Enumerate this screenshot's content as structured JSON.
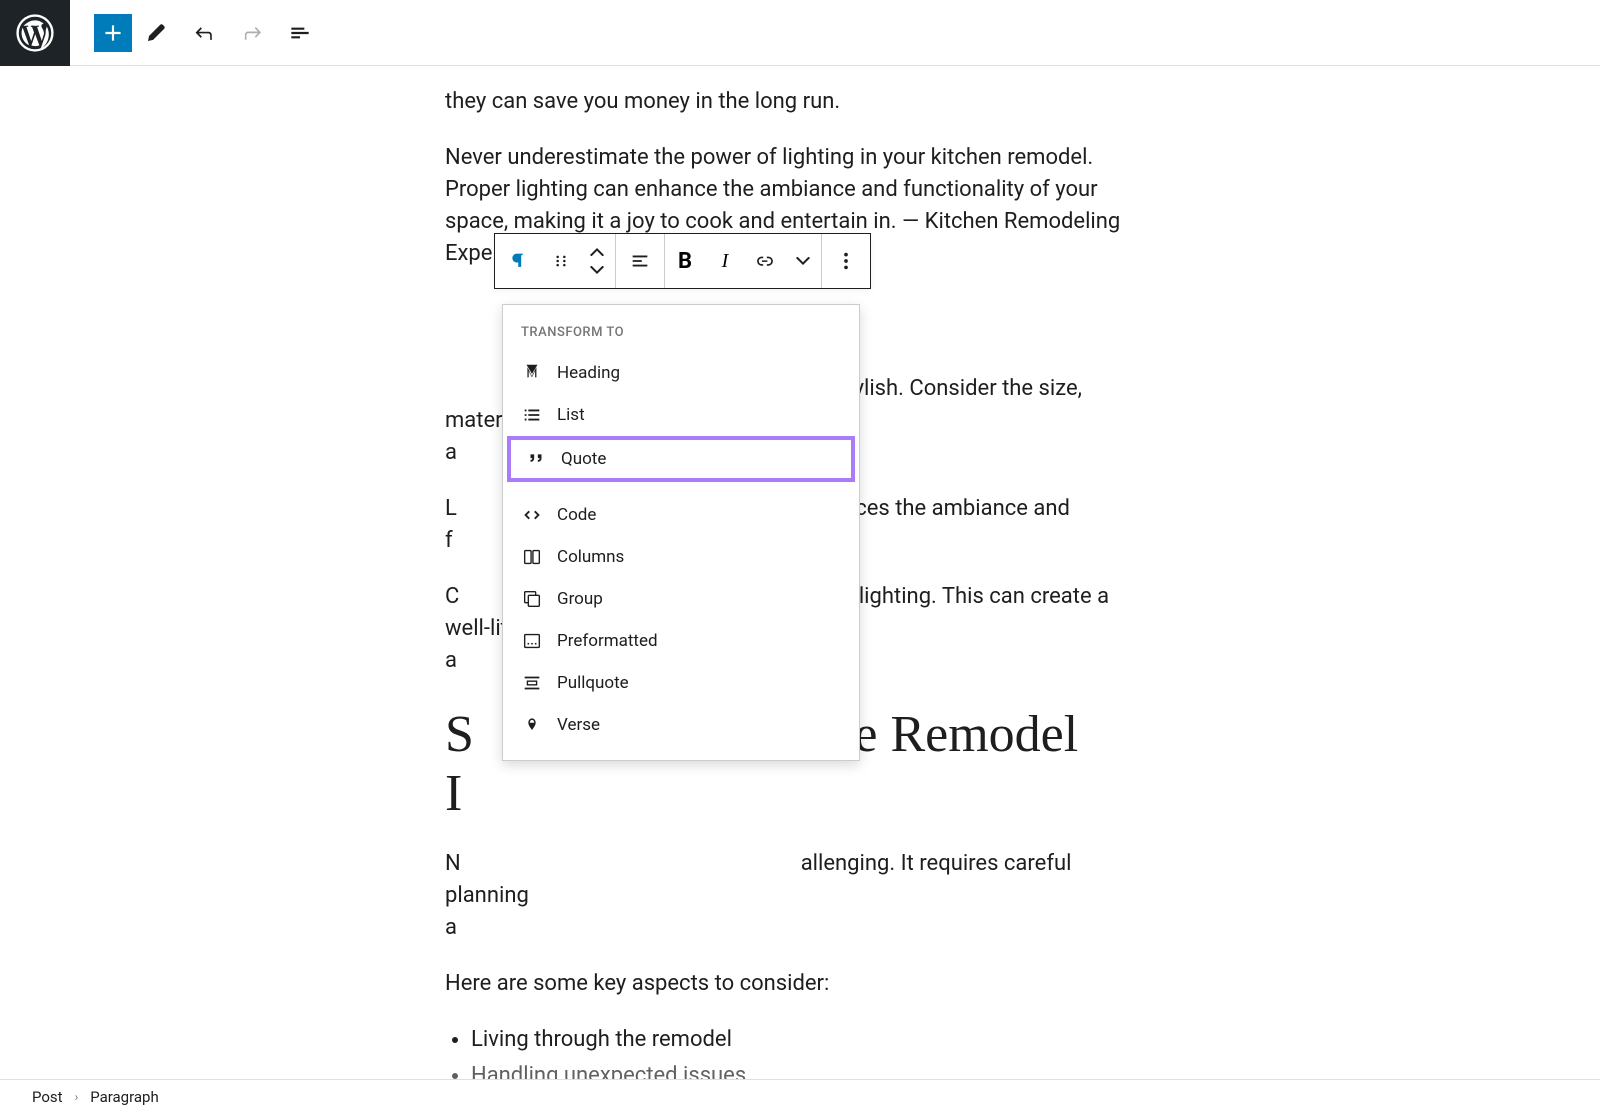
{
  "toolbar": {
    "tools": [
      "edit",
      "undo",
      "redo",
      "document-outline"
    ]
  },
  "content": {
    "para1": "they can save you money in the long run.",
    "para2": "Never underestimate the power of lighting in your kitchen remodel. Proper lighting can enhance the ambiance and functionality of your space, making it a joy to cook and entertain in. — Kitchen Remodeling Expert.",
    "para3_visible": "nd stylish. Consider the size, material,",
    "para3b": "a",
    "para4_visible": "nhances the ambiance and",
    "para4_prefix": "L",
    "para4b": "f",
    "para5_visible": "ccent lighting. This can create a well-lit",
    "para5_prefix": "C",
    "para5b": "a",
    "heading_visible": "the Remodel",
    "heading_prefix": "S",
    "heading_line2": "I",
    "para6_visible": "allenging. It requires careful planning",
    "para6_prefix": "N",
    "para6b": "a",
    "para7": "Here are some key aspects to consider:",
    "list": [
      "Living through the remodel",
      "Handling unexpected issues"
    ]
  },
  "blockToolbar": {
    "buttons": [
      "paragraph",
      "drag",
      "move-up-down",
      "align",
      "bold",
      "italic",
      "link",
      "more-rich",
      "options"
    ]
  },
  "transformMenu": {
    "header": "TRANSFORM TO",
    "items": [
      {
        "icon": "heading",
        "label": "Heading"
      },
      {
        "icon": "list",
        "label": "List"
      },
      {
        "icon": "quote",
        "label": "Quote",
        "highlighted": true
      },
      {
        "icon": "code",
        "label": "Code"
      },
      {
        "icon": "columns",
        "label": "Columns"
      },
      {
        "icon": "group",
        "label": "Group"
      },
      {
        "icon": "preformatted",
        "label": "Preformatted"
      },
      {
        "icon": "pullquote",
        "label": "Pullquote"
      },
      {
        "icon": "verse",
        "label": "Verse"
      }
    ]
  },
  "breadcrumb": {
    "items": [
      "Post",
      "Paragraph"
    ]
  }
}
